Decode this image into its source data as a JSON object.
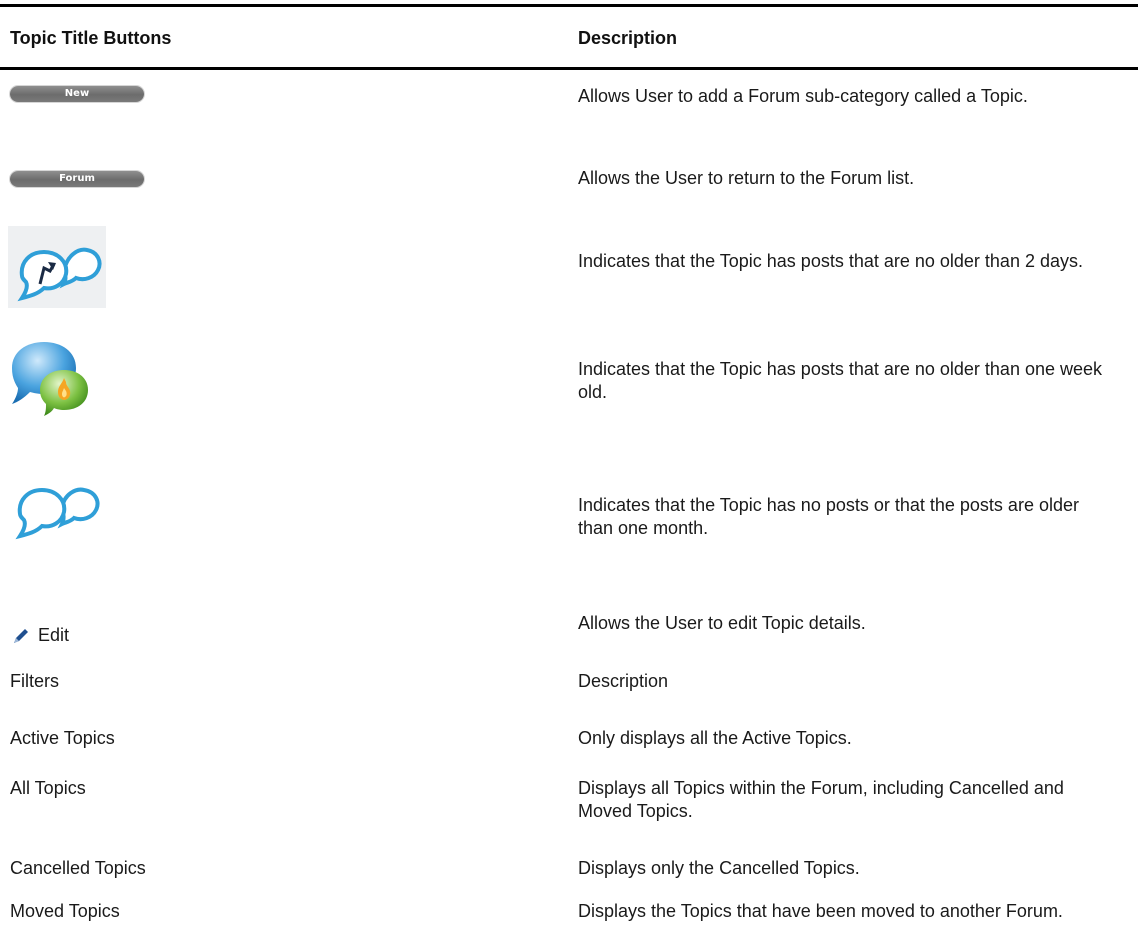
{
  "table": {
    "headers": {
      "col1": "Topic Title Buttons",
      "col2": "Description"
    },
    "button_rows": [
      {
        "label": "New",
        "description": "Allows User to add a Forum sub-category called a Topic."
      },
      {
        "label": "Forum",
        "description": "Allows the User to return to the Forum list."
      },
      {
        "icon": "recent-posts-chat-icon",
        "description": "Indicates that the Topic has posts that are no older than 2 days."
      },
      {
        "icon": "hot-topic-chat-icon",
        "description": "Indicates that the Topic has posts that are no older than one week old."
      },
      {
        "icon": "empty-chat-icon",
        "description": "Indicates that the Topic has no posts or that the posts are older than one month."
      },
      {
        "icon": "pencil-icon",
        "label": "Edit",
        "description": "Allows the User to edit Topic details."
      }
    ],
    "filters_header": {
      "col1": "Filters",
      "col2": "Description"
    },
    "filter_rows": [
      {
        "label": "Active Topics",
        "description": "Only displays all the Active Topics."
      },
      {
        "label": "All Topics",
        "description": "Displays all Topics within the Forum, including Cancelled and Moved Topics."
      },
      {
        "label": "Cancelled Topics",
        "description": "Displays only the Cancelled Topics."
      },
      {
        "label": "Moved Topics",
        "description": "Displays the Topics that have been moved to another Forum."
      }
    ]
  },
  "colors": {
    "rule": "#000000",
    "pill": "#7a7a7a",
    "chat_blue": "#2f9fd8",
    "chat_green": "#7dc143",
    "flame": "#f5a623"
  }
}
